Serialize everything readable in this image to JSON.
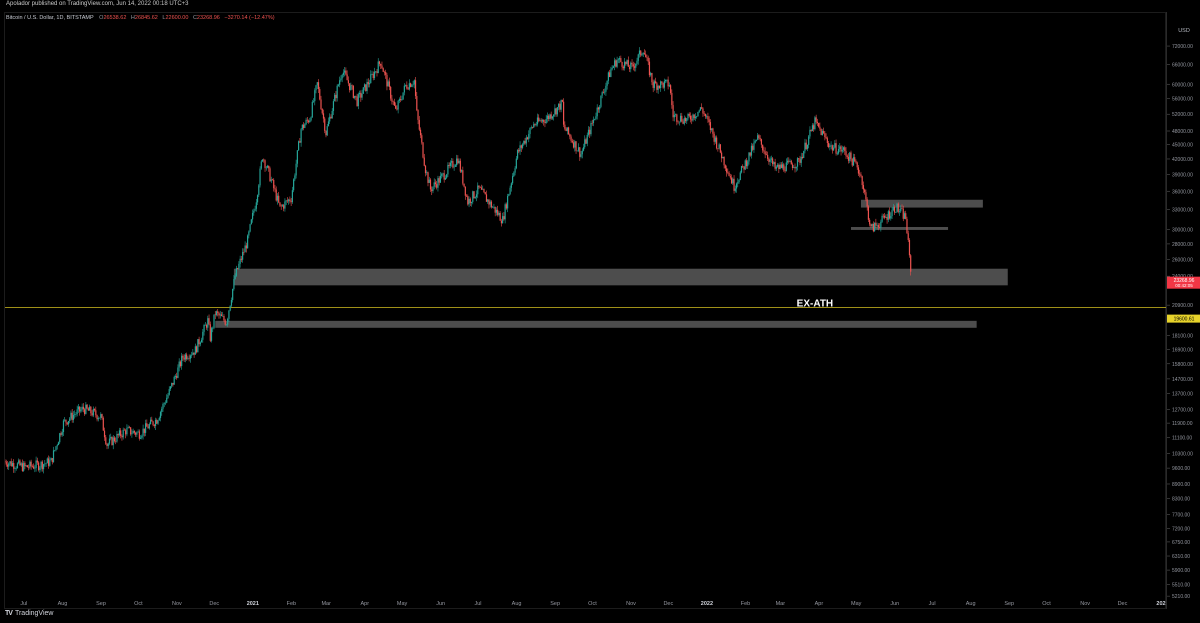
{
  "header": {
    "published": "Apolador published on TradingView.com, Jun 14, 2022 00:18 UTC+3"
  },
  "legend": {
    "symbol": "Bitcoin / U.S. Dollar, 1D, BITSTAMP",
    "o_label": "O",
    "o_value": "26538.62",
    "h_label": "H",
    "h_value": "26845.62",
    "l_label": "L",
    "l_value": "22600.00",
    "c_label": "C",
    "c_value": "23268.96",
    "change": "−3270.14 (−12.47%)"
  },
  "footer": {
    "brand": "TradingView",
    "logo": "tradingview-logo"
  },
  "colors": {
    "background": "#000000",
    "up": "#26a69a",
    "down": "#ef5350",
    "zone": "#5a5a5a",
    "ex_ath_line": "#d4c021",
    "price_tag_bg": "#f23645",
    "ath_tag_bg": "#e7d32b"
  },
  "chart_data": {
    "type": "candlestick",
    "currency_label": "USD",
    "y_scale": "log",
    "ylim": [
      4900,
      80000
    ],
    "x_range": [
      "2020-06-15",
      "2023-01-05"
    ],
    "y_ticks": [
      "78000.00",
      "72000.00",
      "66000.00",
      "60000.00",
      "56000.00",
      "52000.00",
      "48000.00",
      "45000.00",
      "42000.00",
      "39000.00",
      "36000.00",
      "33000.00",
      "30000.00",
      "28000.00",
      "26000.00",
      "24000.00",
      "20900.00",
      "18100.00",
      "16900.00",
      "15800.00",
      "14700.00",
      "13700.00",
      "12700.00",
      "11900.00",
      "11100.00",
      "10300.00",
      "9600.00",
      "8900.00",
      "8300.00",
      "7700.00",
      "7200.00",
      "6750.00",
      "6310.00",
      "5900.00",
      "5510.00",
      "5210.00"
    ],
    "x_ticks": [
      {
        "label": "Jul",
        "date": "2020-07-01"
      },
      {
        "label": "Aug",
        "date": "2020-08-01"
      },
      {
        "label": "Sep",
        "date": "2020-09-01"
      },
      {
        "label": "Oct",
        "date": "2020-10-01"
      },
      {
        "label": "Nov",
        "date": "2020-11-01"
      },
      {
        "label": "Dec",
        "date": "2020-12-01"
      },
      {
        "label": "2021",
        "date": "2021-01-01",
        "bold": true
      },
      {
        "label": "Feb",
        "date": "2021-02-01"
      },
      {
        "label": "Mar",
        "date": "2021-03-01"
      },
      {
        "label": "Apr",
        "date": "2021-04-01"
      },
      {
        "label": "May",
        "date": "2021-05-01"
      },
      {
        "label": "Jun",
        "date": "2021-06-01"
      },
      {
        "label": "Jul",
        "date": "2021-07-01"
      },
      {
        "label": "Aug",
        "date": "2021-08-01"
      },
      {
        "label": "Sep",
        "date": "2021-09-01"
      },
      {
        "label": "Oct",
        "date": "2021-10-01"
      },
      {
        "label": "Nov",
        "date": "2021-11-01"
      },
      {
        "label": "Dec",
        "date": "2021-12-01"
      },
      {
        "label": "2022",
        "date": "2022-01-01",
        "bold": true
      },
      {
        "label": "Feb",
        "date": "2022-02-01"
      },
      {
        "label": "Mar",
        "date": "2022-03-01"
      },
      {
        "label": "Apr",
        "date": "2022-04-01"
      },
      {
        "label": "May",
        "date": "2022-05-01"
      },
      {
        "label": "Jun",
        "date": "2022-06-01"
      },
      {
        "label": "Jul",
        "date": "2022-07-01"
      },
      {
        "label": "Aug",
        "date": "2022-08-01"
      },
      {
        "label": "Sep",
        "date": "2022-09-01"
      },
      {
        "label": "Oct",
        "date": "2022-10-01"
      },
      {
        "label": "Nov",
        "date": "2022-11-01"
      },
      {
        "label": "Dec",
        "date": "2022-12-01"
      },
      {
        "label": "202",
        "date": "2023-01-01",
        "bold": true
      }
    ],
    "price_path": [
      [
        "2020-06-15",
        9400
      ],
      [
        "2020-07-01",
        9150
      ],
      [
        "2020-07-12",
        9250
      ],
      [
        "2020-07-22",
        9400
      ],
      [
        "2020-08-01",
        11300
      ],
      [
        "2020-08-10",
        11800
      ],
      [
        "2020-08-17",
        12100
      ],
      [
        "2020-08-31",
        11650
      ],
      [
        "2020-09-05",
        10200
      ],
      [
        "2020-09-20",
        10900
      ],
      [
        "2020-10-01",
        10750
      ],
      [
        "2020-10-15",
        11500
      ],
      [
        "2020-10-25",
        13100
      ],
      [
        "2020-11-05",
        15500
      ],
      [
        "2020-11-15",
        16000
      ],
      [
        "2020-11-25",
        18400
      ],
      [
        "2020-11-27",
        17000
      ],
      [
        "2020-12-01",
        19100
      ],
      [
        "2020-12-10",
        18300
      ],
      [
        "2020-12-17",
        22800
      ],
      [
        "2020-12-27",
        27000
      ],
      [
        "2021-01-03",
        33000
      ],
      [
        "2021-01-08",
        40500
      ],
      [
        "2021-01-15",
        36000
      ],
      [
        "2021-01-22",
        31500
      ],
      [
        "2021-01-31",
        33100
      ],
      [
        "2021-02-08",
        46000
      ],
      [
        "2021-02-15",
        48500
      ],
      [
        "2021-02-21",
        57000
      ],
      [
        "2021-02-28",
        45200
      ],
      [
        "2021-03-13",
        61000
      ],
      [
        "2021-03-25",
        52500
      ],
      [
        "2021-04-05",
        58500
      ],
      [
        "2021-04-13",
        63500
      ],
      [
        "2021-04-25",
        50000
      ],
      [
        "2021-05-03",
        56500
      ],
      [
        "2021-05-10",
        58000
      ],
      [
        "2021-05-12",
        49500
      ],
      [
        "2021-05-19",
        38000
      ],
      [
        "2021-05-23",
        34500
      ],
      [
        "2021-06-01",
        36500
      ],
      [
        "2021-06-14",
        40000
      ],
      [
        "2021-06-22",
        32500
      ],
      [
        "2021-07-01",
        34500
      ],
      [
        "2021-07-20",
        29800
      ],
      [
        "2021-08-01",
        41000
      ],
      [
        "2021-08-14",
        47000
      ],
      [
        "2021-08-25",
        48500
      ],
      [
        "2021-09-06",
        52000
      ],
      [
        "2021-09-07",
        46500
      ],
      [
        "2021-09-21",
        40800
      ],
      [
        "2021-10-01",
        48000
      ],
      [
        "2021-10-15",
        61000
      ],
      [
        "2021-10-20",
        64000
      ],
      [
        "2021-11-01",
        61500
      ],
      [
        "2021-11-10",
        67500
      ],
      [
        "2021-11-18",
        56800
      ],
      [
        "2021-12-01",
        57000
      ],
      [
        "2021-12-04",
        49000
      ],
      [
        "2021-12-15",
        48000
      ],
      [
        "2021-12-27",
        50700
      ],
      [
        "2022-01-01",
        47500
      ],
      [
        "2022-01-10",
        41800
      ],
      [
        "2022-01-22",
        35000
      ],
      [
        "2022-02-10",
        44000
      ],
      [
        "2022-02-24",
        38000
      ],
      [
        "2022-03-15",
        39200
      ],
      [
        "2022-03-28",
        47500
      ],
      [
        "2022-04-10",
        42200
      ],
      [
        "2022-04-20",
        41500
      ],
      [
        "2022-05-01",
        38500
      ],
      [
        "2022-05-05",
        36000
      ],
      [
        "2022-05-12",
        28500
      ],
      [
        "2022-05-20",
        29500
      ],
      [
        "2022-06-01",
        31700
      ],
      [
        "2022-06-09",
        30100
      ],
      [
        "2022-06-13",
        23268.96
      ]
    ],
    "zones": [
      {
        "name": "upper-resistance-zone",
        "from_date": "2022-05-04",
        "to_date": "2022-08-10",
        "y_low": 31600,
        "y_high": 32800
      },
      {
        "name": "range-low-line",
        "from_date": "2022-04-26",
        "to_date": "2022-07-13",
        "y_low": 28400,
        "y_high": 28800
      },
      {
        "name": "support-zone-ath-2017-breakout",
        "from_date": "2020-12-16",
        "to_date": "2022-08-30",
        "y_low": 21800,
        "y_high": 23600
      },
      {
        "name": "support-zone-lower",
        "from_date": "2020-12-01",
        "to_date": "2022-08-05",
        "y_low": 17800,
        "y_high": 18400
      }
    ],
    "ex_ath": {
      "value": 19600,
      "label": "EX-ATH",
      "value_label": "19600.61"
    },
    "last_price": {
      "value": 23268.96,
      "label": "23268.96",
      "sub": "00:42:05"
    }
  }
}
